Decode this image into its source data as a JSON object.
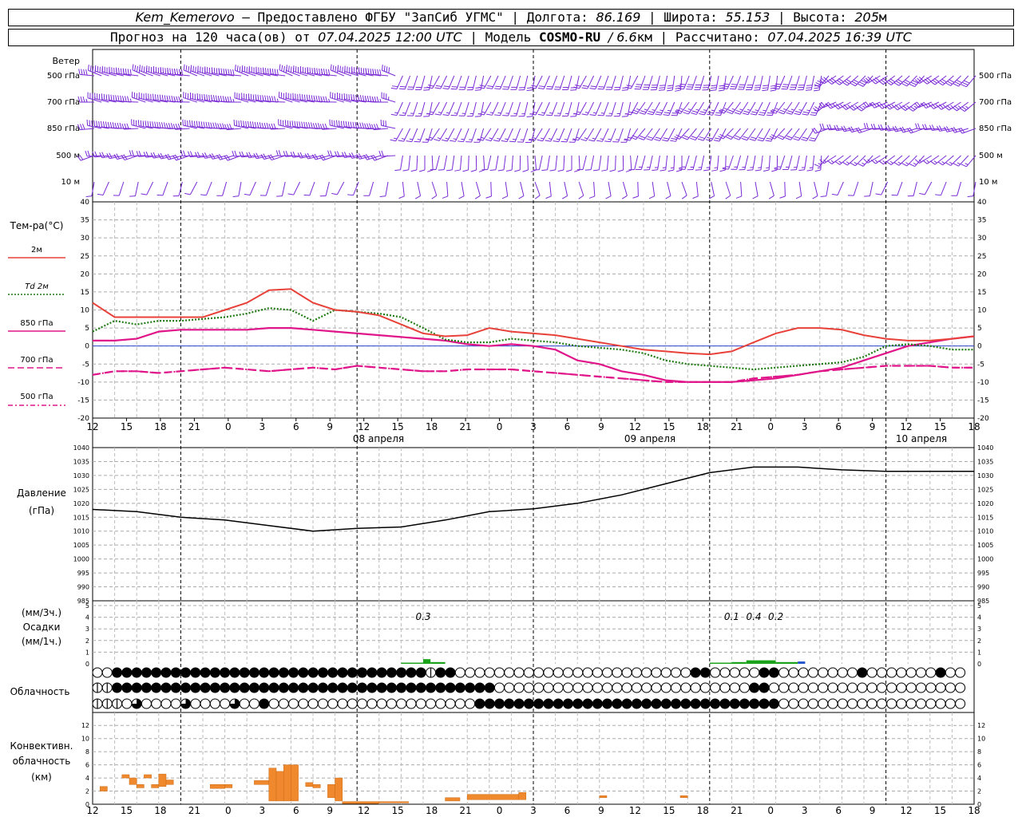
{
  "header": {
    "line1": {
      "station": "Kem_Kemerovo",
      "provider": "— Предоставлено ФГБУ \"ЗапСиб УГМС\" | Долгота:",
      "lon": "86.169",
      "lat_label": "| Широта:",
      "lat": "55.153",
      "alt_label": "| Высота:",
      "alt": "205",
      "alt_unit": "м"
    },
    "line2": {
      "forecast_label": "Прогноз на 120 часа(ов) от",
      "start": "07.04.2025 12:00 UTC",
      "model_label": "| Модель",
      "model": "COSMO-RU",
      "resolution": "/ 6.6",
      "res_unit": "км",
      "calc_label": "| Рассчитано:",
      "calc": "07.04.2025 16:39 UTC"
    }
  },
  "labels": {
    "wind_title": "Ветер",
    "wind_levels": [
      "500 гПа",
      "700 гПа",
      "850 гПа",
      "500 м",
      "10  м"
    ],
    "temp_title": "Тем-ра(°С)",
    "temp_legend": [
      {
        "text": "2м",
        "color": "#e8413a",
        "style": "solid"
      },
      {
        "text": "Td  2м",
        "color": "#1f7a12",
        "style": "dotted"
      },
      {
        "text": "850 гПа",
        "color": "#e0158a",
        "style": "solid"
      },
      {
        "text": "700 гПа",
        "color": "#e0158a",
        "style": "dashed"
      },
      {
        "text": "500 гПа",
        "color": "#e0158a",
        "style": "dashdot"
      }
    ],
    "pressure_title": "Давление",
    "pressure_unit": "(гПа)",
    "precip_unit1": "(мм/3ч.)",
    "precip_title": "Осадки",
    "precip_unit2": "(мм/1ч.)",
    "cloud_title": "Облачность",
    "conv_title1": "Конвективн.",
    "conv_title2": "облачность",
    "conv_unit": "(км)",
    "dates": [
      "08 апреля",
      "09 апреля",
      "10 апреля"
    ]
  },
  "chart_data": [
    {
      "type": "line",
      "title": "Тем-ра(°С)",
      "hours": [
        0,
        3,
        6,
        9,
        12,
        15,
        18,
        21,
        24,
        27,
        30,
        33,
        36,
        39,
        42,
        45,
        48,
        51,
        54,
        57,
        60,
        63,
        66,
        69,
        72,
        75,
        78,
        81,
        84,
        87,
        90,
        93,
        96,
        99,
        102,
        105,
        108,
        111,
        114,
        117,
        120
      ],
      "x_tick_labels": [
        "12",
        "15",
        "18",
        "21",
        "0",
        "3",
        "6",
        "9",
        "12",
        "15",
        "18",
        "21",
        "0",
        "3",
        "6",
        "9",
        "12",
        "15",
        "18",
        "21",
        "0",
        "3",
        "6",
        "9",
        "12",
        "15",
        "18"
      ],
      "ylim": [
        -20,
        40
      ],
      "series": [
        {
          "name": "2м",
          "color": "#e8413a",
          "values": [
            12,
            8,
            8,
            8,
            8,
            8,
            10,
            12,
            15.5,
            15.8,
            12,
            10,
            9.5,
            8.5,
            6,
            3.5,
            2.7,
            3,
            5,
            4,
            3.5,
            3,
            2,
            1,
            0,
            -1,
            -1.5,
            -2,
            -2.3,
            -1.5,
            1,
            3.5,
            5,
            5,
            4.5,
            3,
            2,
            1.5,
            1.5,
            2,
            2.7
          ]
        },
        {
          "name": "Td  2м",
          "color": "#1f7a12",
          "values": [
            4,
            7,
            6,
            7,
            7,
            7.5,
            8,
            9,
            10.5,
            10,
            7,
            10,
            9.5,
            9,
            8,
            5,
            1.8,
            1,
            1,
            2,
            1.5,
            1,
            0,
            -0.5,
            -1,
            -2,
            -4,
            -5,
            -5.5,
            -6,
            -6.5,
            -6,
            -5.5,
            -5,
            -4.5,
            -3,
            0,
            0.5,
            0,
            -1,
            -1
          ]
        },
        {
          "name": "850 гПа",
          "color": "#e0158a",
          "values": [
            1.5,
            1.5,
            2,
            4,
            4.5,
            4.5,
            4.5,
            4.5,
            5,
            5,
            4.5,
            4,
            3.5,
            3,
            2.5,
            2,
            1.5,
            0.5,
            0,
            0.5,
            0,
            -1,
            -4,
            -5,
            -7,
            -8,
            -9.5,
            -10,
            -10,
            -10,
            -9.5,
            -9,
            -8,
            -7,
            -6,
            -4,
            -2,
            0,
            1,
            2,
            2.7
          ]
        },
        {
          "name": "700 гПа",
          "color": "#e0158a",
          "values": [
            -8,
            -7,
            -7,
            -7.5,
            -7,
            -6.5,
            -6,
            -6.5,
            -7,
            -6.5,
            -6,
            -6.5,
            -5.5,
            -6,
            -6.5,
            -7,
            -7,
            -6.5,
            -6.5,
            -6.5,
            -7,
            -7.5,
            -8,
            -8.5,
            -9,
            -9.5,
            -10,
            -10,
            -10,
            -10,
            -9,
            -8.5,
            -8,
            -7,
            -6.5,
            -6,
            -5.5,
            -5.5,
            -5.5,
            -6,
            -6
          ]
        },
        {
          "name": "500 гПа",
          "color": "#e0158a",
          "values": [
            -8,
            -7,
            -7,
            -7.5,
            -7,
            -6.5,
            -6,
            -6.5,
            -7,
            -6.5,
            -6,
            -6.5,
            -5.5,
            -6,
            -6.5,
            -7,
            -7,
            -6.5,
            -6.5,
            -6.5,
            -7,
            -7.5,
            -8,
            -8.5,
            -9,
            -9.5,
            -10,
            -10,
            -10,
            -10,
            -9,
            -8.5,
            -8,
            -7,
            -6.5,
            -6,
            -5.5,
            -5.5,
            -5.5,
            -6,
            -6
          ]
        }
      ]
    },
    {
      "type": "line",
      "title": "Давление",
      "ylabel": "(гПа)",
      "ylim": [
        985,
        1040
      ],
      "series": [
        {
          "name": "Давление",
          "color": "#000000",
          "hours": [
            0,
            6,
            12,
            18,
            24,
            30,
            36,
            42,
            48,
            54,
            60,
            66,
            72,
            78,
            84,
            90,
            96,
            102,
            108,
            114,
            120
          ],
          "values": [
            1017.8,
            1017,
            1015,
            1014,
            1012,
            1010,
            1011,
            1011.5,
            1014,
            1017,
            1018,
            1020,
            1023,
            1027,
            1031,
            1033,
            1033,
            1032,
            1031.5,
            1031.5,
            1031.5
          ]
        }
      ]
    },
    {
      "type": "bar",
      "title": "Осадки",
      "ylim": [
        0,
        5
      ],
      "annotations": [
        {
          "hour": 45,
          "text": "0.3"
        },
        {
          "hour": 87,
          "text": "0.1"
        },
        {
          "hour": 90,
          "text": "0.4"
        },
        {
          "hour": 93,
          "text": "0.2"
        }
      ],
      "bars": [
        {
          "h0": 42,
          "h1": 45,
          "value": 0.1,
          "color": "#1aa31a"
        },
        {
          "h0": 45,
          "h1": 46,
          "value": 0.4,
          "color": "#1aa31a"
        },
        {
          "h0": 46,
          "h1": 48,
          "value": 0.15,
          "color": "#1aa31a"
        },
        {
          "h0": 84,
          "h1": 87,
          "value": 0.1,
          "color": "#1aa31a"
        },
        {
          "h0": 87,
          "h1": 89,
          "value": 0.15,
          "color": "#1aa31a"
        },
        {
          "h0": 89,
          "h1": 93,
          "value": 0.3,
          "color": "#1aa31a"
        },
        {
          "h0": 93,
          "h1": 96,
          "value": 0.15,
          "color": "#1aa31a"
        },
        {
          "h0": 96,
          "h1": 97,
          "value": 0.2,
          "color": "#2255cc"
        }
      ]
    },
    {
      "type": "bar",
      "title": "Конвективн. облачность",
      "ylabel": "(км)",
      "ylim": [
        0,
        13
      ],
      "bars": [
        {
          "h0": 1,
          "h1": 2,
          "bottom": 2,
          "top": 2.7
        },
        {
          "h0": 4,
          "h1": 5,
          "bottom": 4,
          "top": 4.5
        },
        {
          "h0": 5,
          "h1": 6,
          "bottom": 3,
          "top": 4
        },
        {
          "h0": 6,
          "h1": 7,
          "bottom": 2.5,
          "top": 3
        },
        {
          "h0": 7,
          "h1": 8,
          "bottom": 4,
          "top": 4.5
        },
        {
          "h0": 8,
          "h1": 9,
          "bottom": 2.5,
          "top": 3
        },
        {
          "h0": 9,
          "h1": 10,
          "bottom": 2.7,
          "top": 4.6
        },
        {
          "h0": 10,
          "h1": 11,
          "bottom": 3,
          "top": 3.7
        },
        {
          "h0": 16,
          "h1": 18,
          "bottom": 2.4,
          "top": 3
        },
        {
          "h0": 18,
          "h1": 19,
          "bottom": 2.5,
          "top": 3
        },
        {
          "h0": 22,
          "h1": 24,
          "bottom": 3,
          "top": 3.6
        },
        {
          "h0": 24,
          "h1": 25,
          "bottom": 0.5,
          "top": 5.5
        },
        {
          "h0": 25,
          "h1": 26,
          "bottom": 0.5,
          "top": 5
        },
        {
          "h0": 26,
          "h1": 27,
          "bottom": 0.5,
          "top": 6
        },
        {
          "h0": 27,
          "h1": 28,
          "bottom": 0.5,
          "top": 6
        },
        {
          "h0": 29,
          "h1": 30,
          "bottom": 2.7,
          "top": 3.3
        },
        {
          "h0": 30,
          "h1": 31,
          "bottom": 2.5,
          "top": 3
        },
        {
          "h0": 32,
          "h1": 33,
          "bottom": 1,
          "top": 3
        },
        {
          "h0": 33,
          "h1": 34,
          "bottom": 0.5,
          "top": 4
        },
        {
          "h0": 34,
          "h1": 39,
          "bottom": 0.1,
          "top": 0.4
        },
        {
          "h0": 39,
          "h1": 43,
          "bottom": 0.2,
          "top": 0.4
        },
        {
          "h0": 48,
          "h1": 50,
          "bottom": 0.5,
          "top": 1
        },
        {
          "h0": 51,
          "h1": 58,
          "bottom": 0.7,
          "top": 1.5
        },
        {
          "h0": 58,
          "h1": 59,
          "bottom": 0.7,
          "top": 1.8
        },
        {
          "h0": 69,
          "h1": 70,
          "bottom": 1,
          "top": 1.3
        },
        {
          "h0": 80,
          "h1": 81,
          "bottom": 1,
          "top": 1.3
        }
      ]
    }
  ],
  "wind_rows": 5,
  "cloud_rows": {
    "comment_free": true,
    "rows": [
      "oo33333333333333333333333333333333133oooooooooooooooooooooooo33ooooo33oooooooo3ooooooo3ooooooooooooooooooooo",
      "11333333333333333333333333333333333333333oooooooooooooooooooooooooo33ooooooooooooooooooooooooooooooooooooooo",
      "111o2oooo2oooo2oo3ooooooooooooooooooooo3333333333333333333333333333333ooooooooooooooooooooooooooooooooooooo"
    ]
  }
}
